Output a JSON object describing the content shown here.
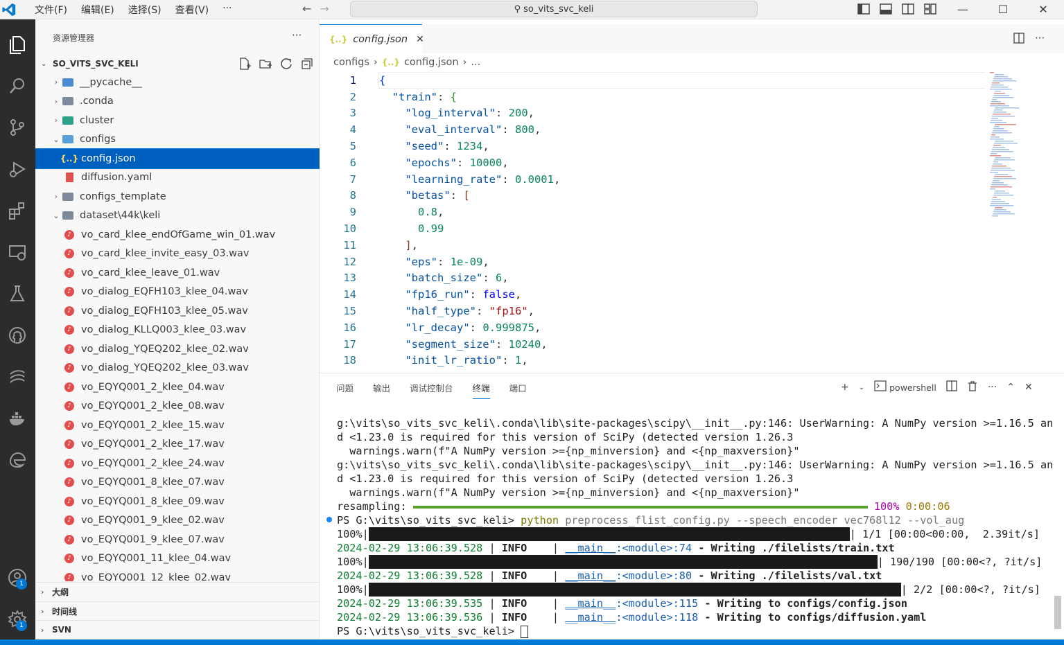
{
  "titlebar": {
    "menus": [
      "文件(F)",
      "编辑(E)",
      "选择(S)",
      "查看(V)",
      "···"
    ],
    "search_text": "so_vits_svc_keli",
    "win_min": "—",
    "win_max": "☐",
    "win_close": "✕"
  },
  "activity": {
    "account_badge": "1",
    "settings_badge": "1"
  },
  "sidebar": {
    "title": "资源管理器",
    "more": "···",
    "root": "SO_VITS_SVC_KELI",
    "items": [
      {
        "label": "__pycache__",
        "chev": "›",
        "kind": "folder-py",
        "indent": 0
      },
      {
        "label": ".conda",
        "chev": "›",
        "kind": "folder",
        "indent": 0
      },
      {
        "label": "cluster",
        "chev": "›",
        "kind": "folder-teal",
        "indent": 0
      },
      {
        "label": "configs",
        "chev": "⌄",
        "kind": "folder-cfg",
        "indent": 0
      },
      {
        "label": "config.json",
        "chev": "",
        "kind": "json",
        "indent": 1,
        "selected": true
      },
      {
        "label": "diffusion.yaml",
        "chev": "",
        "kind": "yaml",
        "indent": 1
      },
      {
        "label": "configs_template",
        "chev": "›",
        "kind": "folder",
        "indent": 0
      },
      {
        "label": "dataset\\44k\\keli",
        "chev": "⌄",
        "kind": "folder",
        "indent": 0
      },
      {
        "label": "vo_card_klee_endOfGame_win_01.wav",
        "chev": "",
        "kind": "wav",
        "indent": 1
      },
      {
        "label": "vo_card_klee_invite_easy_03.wav",
        "chev": "",
        "kind": "wav",
        "indent": 1
      },
      {
        "label": "vo_card_klee_leave_01.wav",
        "chev": "",
        "kind": "wav",
        "indent": 1
      },
      {
        "label": "vo_dialog_EQFH103_klee_04.wav",
        "chev": "",
        "kind": "wav",
        "indent": 1
      },
      {
        "label": "vo_dialog_EQFH103_klee_05.wav",
        "chev": "",
        "kind": "wav",
        "indent": 1
      },
      {
        "label": "vo_dialog_KLLQ003_klee_03.wav",
        "chev": "",
        "kind": "wav",
        "indent": 1
      },
      {
        "label": "vo_dialog_YQEQ202_klee_02.wav",
        "chev": "",
        "kind": "wav",
        "indent": 1
      },
      {
        "label": "vo_dialog_YQEQ202_klee_03.wav",
        "chev": "",
        "kind": "wav",
        "indent": 1
      },
      {
        "label": "vo_EQYQ001_2_klee_04.wav",
        "chev": "",
        "kind": "wav",
        "indent": 1
      },
      {
        "label": "vo_EQYQ001_2_klee_08.wav",
        "chev": "",
        "kind": "wav",
        "indent": 1
      },
      {
        "label": "vo_EQYQ001_2_klee_15.wav",
        "chev": "",
        "kind": "wav",
        "indent": 1
      },
      {
        "label": "vo_EQYQ001_2_klee_17.wav",
        "chev": "",
        "kind": "wav",
        "indent": 1
      },
      {
        "label": "vo_EQYQ001_2_klee_24.wav",
        "chev": "",
        "kind": "wav",
        "indent": 1
      },
      {
        "label": "vo_EQYQ001_8_klee_07.wav",
        "chev": "",
        "kind": "wav",
        "indent": 1
      },
      {
        "label": "vo_EQYQ001_8_klee_09.wav",
        "chev": "",
        "kind": "wav",
        "indent": 1
      },
      {
        "label": "vo_EQYQ001_9_klee_02.wav",
        "chev": "",
        "kind": "wav",
        "indent": 1
      },
      {
        "label": "vo_EQYQ001_9_klee_07.wav",
        "chev": "",
        "kind": "wav",
        "indent": 1
      },
      {
        "label": "vo_EQYQ001_11_klee_04.wav",
        "chev": "",
        "kind": "wav",
        "indent": 1
      },
      {
        "label": "vo_EQYQ001_12_klee_02.wav",
        "chev": "",
        "kind": "wav",
        "indent": 1
      }
    ],
    "sections": [
      "大纲",
      "时间线",
      "SVN"
    ]
  },
  "editor": {
    "tab_label": "config.json",
    "tab_close": "✕",
    "breadcrumb": [
      "configs",
      "config.json",
      "..."
    ],
    "lines": [
      [
        [
          "ob",
          "{"
        ]
      ],
      [
        [
          "p",
          "  "
        ],
        [
          "k",
          "\"train\""
        ],
        [
          "p",
          ": "
        ],
        [
          "ob2",
          "{"
        ]
      ],
      [
        [
          "p",
          "    "
        ],
        [
          "k",
          "\"log_interval\""
        ],
        [
          "p",
          ": "
        ],
        [
          "n",
          "200"
        ],
        [
          "p",
          ","
        ]
      ],
      [
        [
          "p",
          "    "
        ],
        [
          "k",
          "\"eval_interval\""
        ],
        [
          "p",
          ": "
        ],
        [
          "n",
          "800"
        ],
        [
          "p",
          ","
        ]
      ],
      [
        [
          "p",
          "    "
        ],
        [
          "k",
          "\"seed\""
        ],
        [
          "p",
          ": "
        ],
        [
          "n",
          "1234"
        ],
        [
          "p",
          ","
        ]
      ],
      [
        [
          "p",
          "    "
        ],
        [
          "k",
          "\"epochs\""
        ],
        [
          "p",
          ": "
        ],
        [
          "n",
          "10000"
        ],
        [
          "p",
          ","
        ]
      ],
      [
        [
          "p",
          "    "
        ],
        [
          "k",
          "\"learning_rate\""
        ],
        [
          "p",
          ": "
        ],
        [
          "n",
          "0.0001"
        ],
        [
          "p",
          ","
        ]
      ],
      [
        [
          "p",
          "    "
        ],
        [
          "k",
          "\"betas\""
        ],
        [
          "p",
          ": "
        ],
        [
          "ob3",
          "["
        ]
      ],
      [
        [
          "p",
          "      "
        ],
        [
          "n",
          "0.8"
        ],
        [
          "p",
          ","
        ]
      ],
      [
        [
          "p",
          "      "
        ],
        [
          "n",
          "0.99"
        ]
      ],
      [
        [
          "p",
          "    "
        ],
        [
          "ob3",
          "]"
        ],
        [
          "p",
          ","
        ]
      ],
      [
        [
          "p",
          "    "
        ],
        [
          "k",
          "\"eps\""
        ],
        [
          "p",
          ": "
        ],
        [
          "n",
          "1e-09"
        ],
        [
          "p",
          ","
        ]
      ],
      [
        [
          "p",
          "    "
        ],
        [
          "k",
          "\"batch_size\""
        ],
        [
          "p",
          ": "
        ],
        [
          "n",
          "6"
        ],
        [
          "p",
          ","
        ]
      ],
      [
        [
          "p",
          "    "
        ],
        [
          "k",
          "\"fp16_run\""
        ],
        [
          "p",
          ": "
        ],
        [
          "b",
          "false"
        ],
        [
          "p",
          ","
        ]
      ],
      [
        [
          "p",
          "    "
        ],
        [
          "k",
          "\"half_type\""
        ],
        [
          "p",
          ": "
        ],
        [
          "s",
          "\"fp16\""
        ],
        [
          "p",
          ","
        ]
      ],
      [
        [
          "p",
          "    "
        ],
        [
          "k",
          "\"lr_decay\""
        ],
        [
          "p",
          ": "
        ],
        [
          "n",
          "0.999875"
        ],
        [
          "p",
          ","
        ]
      ],
      [
        [
          "p",
          "    "
        ],
        [
          "k",
          "\"segment_size\""
        ],
        [
          "p",
          ": "
        ],
        [
          "n",
          "10240"
        ],
        [
          "p",
          ","
        ]
      ],
      [
        [
          "p",
          "    "
        ],
        [
          "k",
          "\"init_lr_ratio\""
        ],
        [
          "p",
          ": "
        ],
        [
          "n",
          "1"
        ],
        [
          "p",
          ","
        ]
      ]
    ]
  },
  "panel": {
    "tabs": [
      "问题",
      "输出",
      "调试控制台",
      "终端",
      "端口"
    ],
    "active_tab": "终端",
    "shell_label": "powershell",
    "terminal": [
      {
        "text": "g:\\vits\\so_vits_svc_keli\\.conda\\lib\\site-packages\\scipy\\__init__.py:146: UserWarning: A NumPy version >=1.16.5 an"
      },
      {
        "text": "d <1.23.0 is required for this version of SciPy (detected version 1.26.3"
      },
      {
        "text": "  warnings.warn(f\"A NumPy version >={np_minversion} and <{np_maxversion}\""
      },
      {
        "text": "g:\\vits\\so_vits_svc_keli\\.conda\\lib\\site-packages\\scipy\\__init__.py:146: UserWarning: A NumPy version >=1.16.5 an"
      },
      {
        "text": "d <1.23.0 is required for this version of SciPy (detected version 1.26.3"
      },
      {
        "text": "  warnings.warn(f\"A NumPy version >={np_minversion} and <{np_maxversion}\""
      }
    ],
    "resampling": {
      "label": "resampling: ",
      "percent": "100%",
      "time": "0:00:06",
      "fraction": 1.0
    },
    "command": {
      "prompt": "PS G:\\vits\\so_vits_svc_keli> ",
      "exe": "python",
      "rest": " preprocess_flist_config.py --speech_encoder vec768l12 --vol_aug"
    },
    "progress": [
      {
        "pct": "100%|",
        "suffix": "| 1/1 [00:00<00:00,  2.39it/s]",
        "fraction": 1.0
      },
      {
        "pct": "100%|",
        "suffix": "| 190/190 [00:00<?, ?it/s]",
        "fraction": 1.0
      },
      {
        "pct": "100%|",
        "suffix": "| 2/2 [00:00<?, ?it/s]",
        "fraction": 1.0
      }
    ],
    "logs": [
      {
        "ts": "2024-02-29 13:06:39.528",
        "level": "INFO",
        "mod": "__main__",
        "loc": ":<module>:74",
        "msg": " - Writing ./filelists/train.txt"
      },
      {
        "ts": "2024-02-29 13:06:39.528",
        "level": "INFO",
        "mod": "__main__",
        "loc": ":<module>:80",
        "msg": " - Writing ./filelists/val.txt"
      },
      {
        "ts": "2024-02-29 13:06:39.535",
        "level": "INFO",
        "mod": "__main__",
        "loc": ":<module>:115",
        "msg": " - Writing to configs/config.json"
      },
      {
        "ts": "2024-02-29 13:06:39.536",
        "level": "INFO",
        "mod": "__main__",
        "loc": ":<module>:118",
        "msg": " - Writing to configs/diffusion.yaml"
      }
    ],
    "final_prompt": "PS G:\\vits\\so_vits_svc_keli> "
  },
  "colors": {
    "accent": "#0078d4",
    "selected": "#0060c0",
    "activity_bg": "#2c2c2c"
  }
}
